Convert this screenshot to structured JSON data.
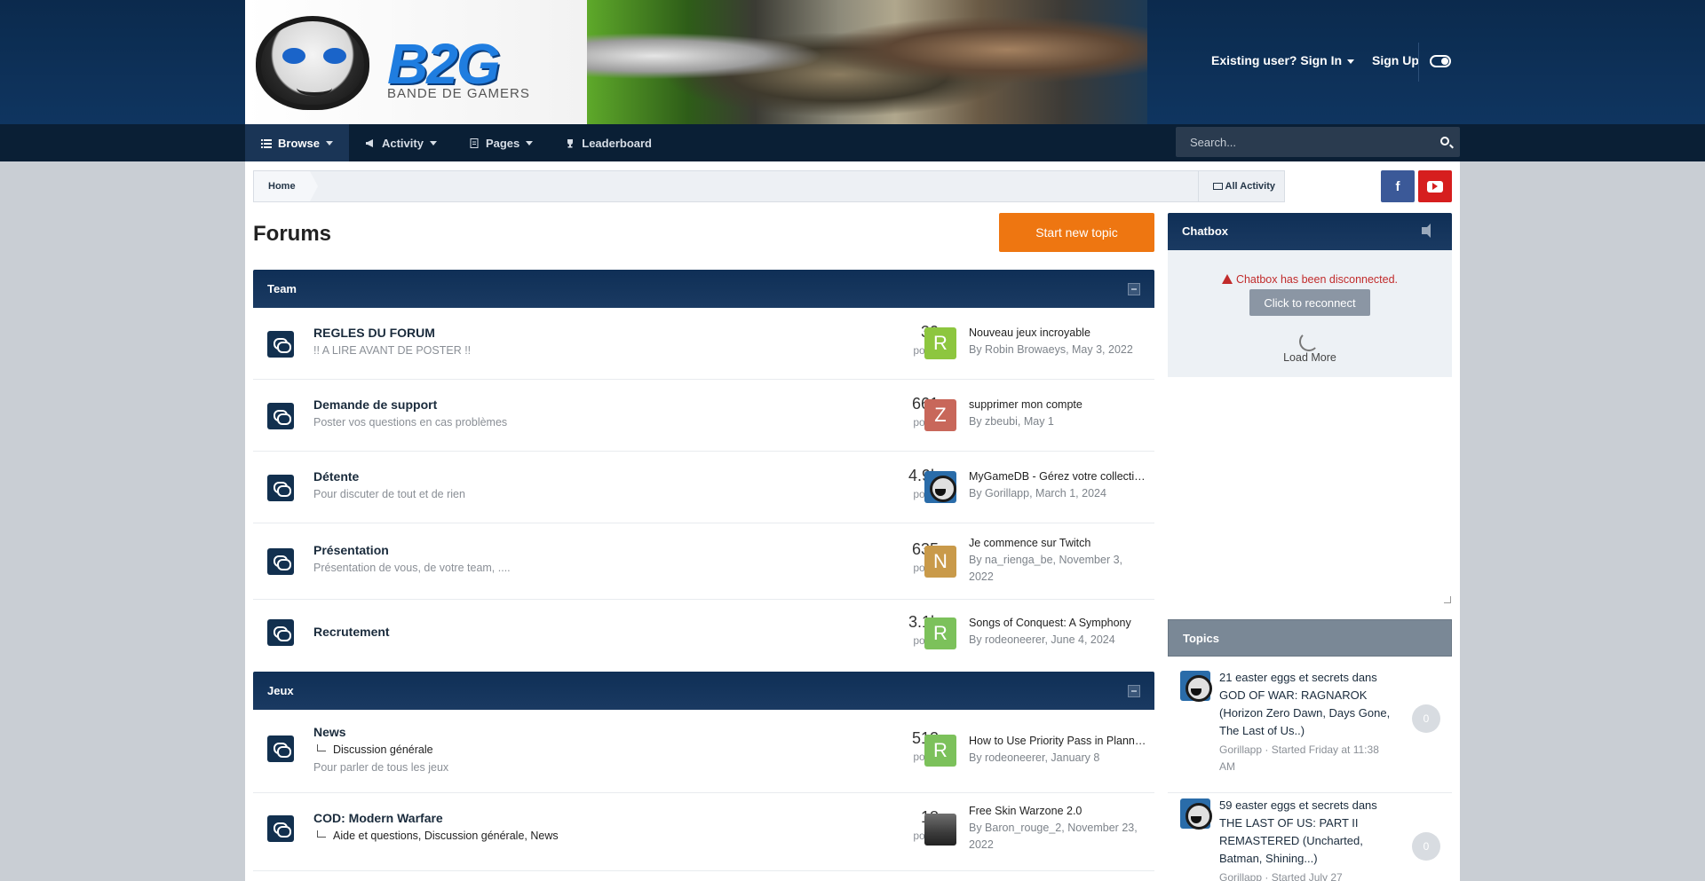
{
  "header": {
    "site_logo_text": "B2G",
    "site_logo_sub": "BANDE DE GAMERS",
    "sign_in": "Existing user? Sign In",
    "sign_up": "Sign Up"
  },
  "nav": {
    "items": [
      {
        "label": "Browse",
        "icon": "list-icon"
      },
      {
        "label": "Activity",
        "icon": "megaphone-icon"
      },
      {
        "label": "Pages",
        "icon": "document-icon"
      },
      {
        "label": "Leaderboard",
        "icon": "trophy-icon"
      }
    ],
    "search_placeholder": "Search..."
  },
  "breadcrumb": {
    "home": "Home",
    "all_activity": "All Activity"
  },
  "social": {
    "facebook": "f"
  },
  "page_title": "Forums",
  "start_topic": "Start new topic",
  "categories": [
    {
      "name": "Team",
      "forums": [
        {
          "title": "REGLES DU FORUM",
          "desc": "!! A LIRE AVANT DE POSTER !!",
          "count": "30",
          "count_label": "posts",
          "avatar_letter": "R",
          "avatar_color": "#8dc63f",
          "last_title": "Nouveau jeux incroyable",
          "last_by": "By Robin Browaeys, May 3, 2022"
        },
        {
          "title": "Demande de support",
          "desc": "Poster vos questions en cas problèmes",
          "count": "661",
          "count_label": "posts",
          "avatar_letter": "Z",
          "avatar_color": "#c8675a",
          "last_title": "supprimer mon compte",
          "last_by": "By zbeubi, May 1"
        },
        {
          "title": "Détente",
          "desc": "Pour discuter de tout et de rien",
          "count": "4.9k",
          "count_label": "posts",
          "avatar_letter": "",
          "avatar_color": "#2a6ca9",
          "last_title": "MyGameDB - Gérez votre collection",
          "last_by": "By Gorillapp, March 1, 2024"
        },
        {
          "title": "Présentation",
          "desc": "Présentation de vous, de votre team, ....",
          "count": "635",
          "count_label": "posts",
          "avatar_letter": "N",
          "avatar_color": "#c99a4a",
          "last_title": "Je commence sur Twitch",
          "last_by": "By na_rienga_be, November 3, 2022"
        },
        {
          "title": "Recrutement",
          "desc": "",
          "count": "3.1k",
          "count_label": "posts",
          "avatar_letter": "R",
          "avatar_color": "#7cc15b",
          "last_title": "Songs of Conquest: A Symphony",
          "last_by": "By rodeoneerer, June 4, 2024"
        }
      ]
    },
    {
      "name": "Jeux",
      "forums": [
        {
          "title": "News",
          "subforums": "Discussion générale",
          "desc": "Pour parler de tous les jeux",
          "count": "512",
          "count_label": "posts",
          "avatar_letter": "R",
          "avatar_color": "#7cc15b",
          "last_title": "How to Use Priority Pass in Planning",
          "last_by": "By rodeoneerer, January 8"
        },
        {
          "title": "COD: Modern Warfare",
          "subforums": "Aide et questions,   Discussion générale,   News",
          "desc": "",
          "count": "18",
          "count_label": "posts",
          "avatar_letter": "",
          "avatar_color": "#555555",
          "last_title": "Free Skin Warzone 2.0",
          "last_by": "By Baron_rouge_2, November 23, 2022"
        }
      ]
    }
  ],
  "chatbox": {
    "title": "Chatbox",
    "disconnected": "Chatbox has been disconnected.",
    "reconnect": "Click to reconnect",
    "load_more": "Load More"
  },
  "topics": {
    "title": "Topics",
    "items": [
      {
        "title": "21 easter eggs et secrets dans GOD OF WAR: RAGNAROK (Horizon Zero Dawn, Days Gone, The Last of Us..)",
        "meta": "Gorillapp · Started Friday at 11:38 AM",
        "count": "0"
      },
      {
        "title": "59 easter eggs et secrets dans THE LAST OF US: PART II REMASTERED (Uncharted, Batman, Shining...)",
        "meta": "Gorillapp · Started July 27",
        "count": "0"
      }
    ]
  }
}
